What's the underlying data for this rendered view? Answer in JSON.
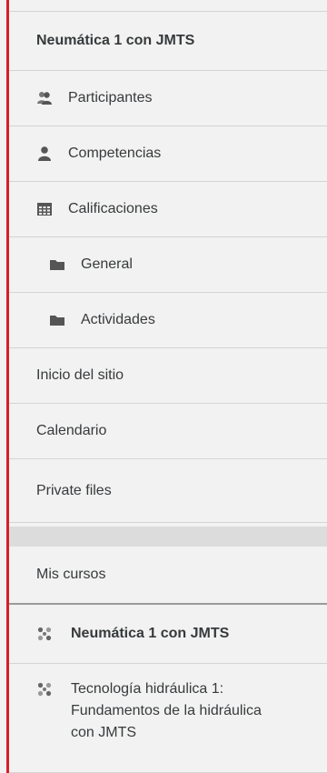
{
  "nav": {
    "course_title": "Neumática 1 con JMTS",
    "items": [
      {
        "label": "Participantes",
        "icon": "participants-icon"
      },
      {
        "label": "Competencias",
        "icon": "user-icon"
      },
      {
        "label": "Calificaciones",
        "icon": "grades-table-icon"
      },
      {
        "label": "General",
        "icon": "folder-icon"
      },
      {
        "label": "Actividades",
        "icon": "folder-icon"
      },
      {
        "label": "Inicio del sitio"
      },
      {
        "label": "Calendario"
      },
      {
        "label": "Private files"
      }
    ]
  },
  "my_courses": {
    "header": "Mis cursos",
    "courses": [
      {
        "label": "Neumática 1 con JMTS",
        "icon": "course-icon",
        "active": true
      },
      {
        "label": "Tecnología hidráulica 1: Fundamentos de la hidráulica con JMTS",
        "icon": "course-icon",
        "active": false
      }
    ]
  },
  "colors": {
    "accent": "#d81e28",
    "background": "#f2f2f2",
    "text": "#373a3c",
    "icon": "#555555"
  }
}
